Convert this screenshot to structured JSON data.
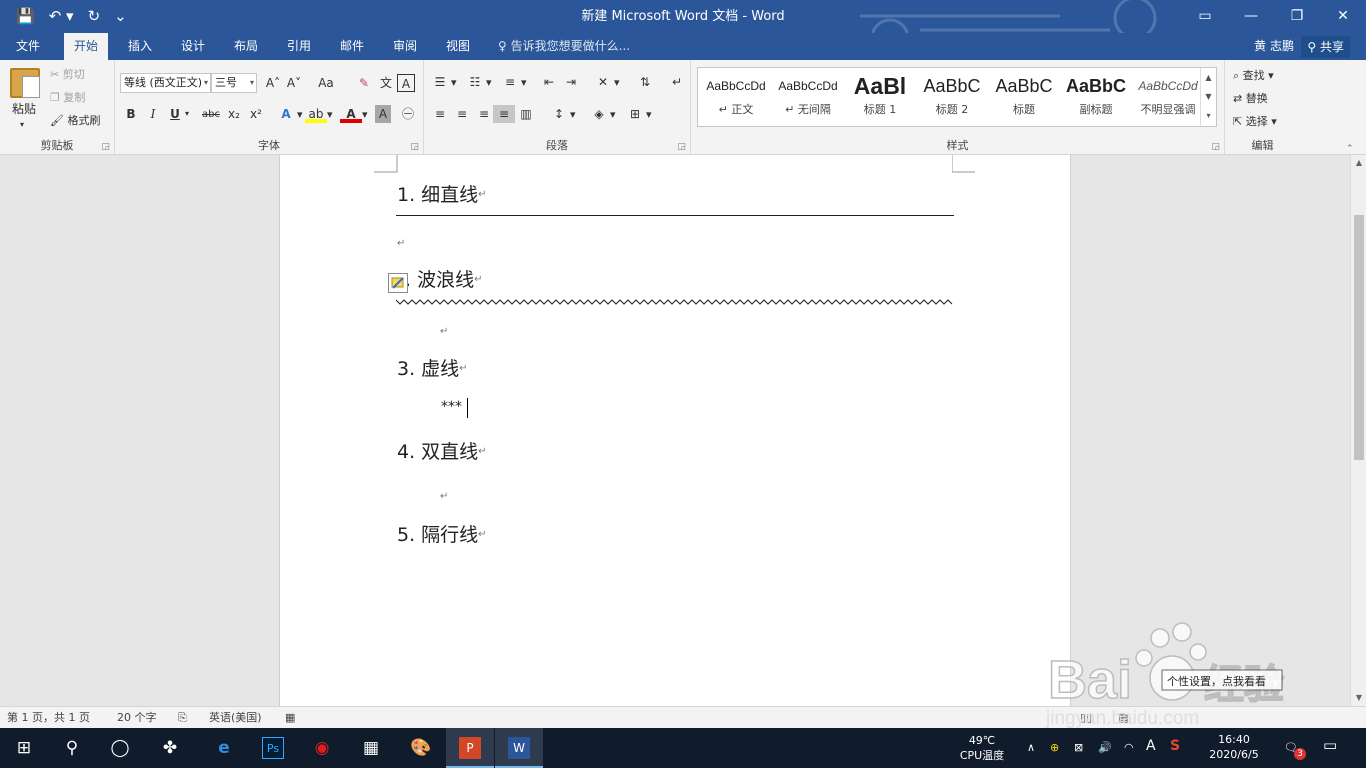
{
  "window": {
    "title": "新建 Microsoft Word 文档 - Word",
    "ctrl_ribbon": "▭",
    "ctrl_min": "—",
    "ctrl_max": "❐",
    "ctrl_close": "✕"
  },
  "qat": {
    "save_icon": "💾",
    "undo_icon": "↶ ▾",
    "redo_icon": "↻",
    "customize_icon": "⌄"
  },
  "tabs": [
    {
      "label": "文件"
    },
    {
      "label": "开始"
    },
    {
      "label": "插入"
    },
    {
      "label": "设计"
    },
    {
      "label": "布局"
    },
    {
      "label": "引用"
    },
    {
      "label": "邮件"
    },
    {
      "label": "审阅"
    },
    {
      "label": "视图"
    }
  ],
  "tell_me": "告诉我您想要做什么...",
  "user_name": "黄 志鹏",
  "share_label": "共享",
  "clipboard": {
    "paste": "粘贴",
    "cut": "剪切",
    "copy": "复制",
    "format_painter": "格式刷",
    "group_label": "剪贴板"
  },
  "font": {
    "font_name": "等线 (西文正文)",
    "font_size": "三号",
    "grow": "A˄",
    "shrink": "A˅",
    "case": "Aa",
    "bold": "B",
    "italic": "I",
    "underline": "U",
    "strike": "abc",
    "sub": "x₂",
    "sup": "x²",
    "group_label": "字体"
  },
  "paragraph": {
    "group_label": "段落"
  },
  "styles": {
    "items": [
      {
        "preview": "AaBbCcDd",
        "label": "↵ 正文"
      },
      {
        "preview": "AaBbCcDd",
        "label": "↵ 无间隔"
      },
      {
        "preview": "AaBl",
        "label": "标题 1"
      },
      {
        "preview": "AaBbC",
        "label": "标题 2"
      },
      {
        "preview": "AaBbC",
        "label": "标题"
      },
      {
        "preview": "AaBbC",
        "label": "副标题"
      },
      {
        "preview": "AaBbCcDd",
        "label": "不明显强调"
      }
    ],
    "group_label": "样式"
  },
  "editing": {
    "find": "查找",
    "replace": "替换",
    "select": "选择",
    "group_label": "编辑"
  },
  "document": {
    "items": [
      {
        "text": "1. 细直线"
      },
      {
        "text": ". 波浪线"
      },
      {
        "text": "3. 虚线"
      },
      {
        "text": "4. 双直线"
      },
      {
        "text": "5. 隔行线"
      }
    ],
    "para_mark": "↵",
    "stars": "***"
  },
  "status": {
    "page": "第 1 页，共 1 页",
    "words": "20 个字",
    "language": "英语(美国)"
  },
  "taskbar": {
    "weather_temp": "49℃",
    "weather_label": "CPU温度",
    "time": "16:40",
    "date": "2020/6/5",
    "notif_count": "3",
    "ime": "A"
  },
  "watermark": {
    "brand": "Bai",
    "brand2": "经验",
    "url": "jingyan.baidu.com",
    "hint": "个性设置，点我看看"
  },
  "colors": {
    "ribbon_blue": "#2b579a",
    "highlight_yellow": "#ffff00",
    "font_red": "#e00000"
  }
}
